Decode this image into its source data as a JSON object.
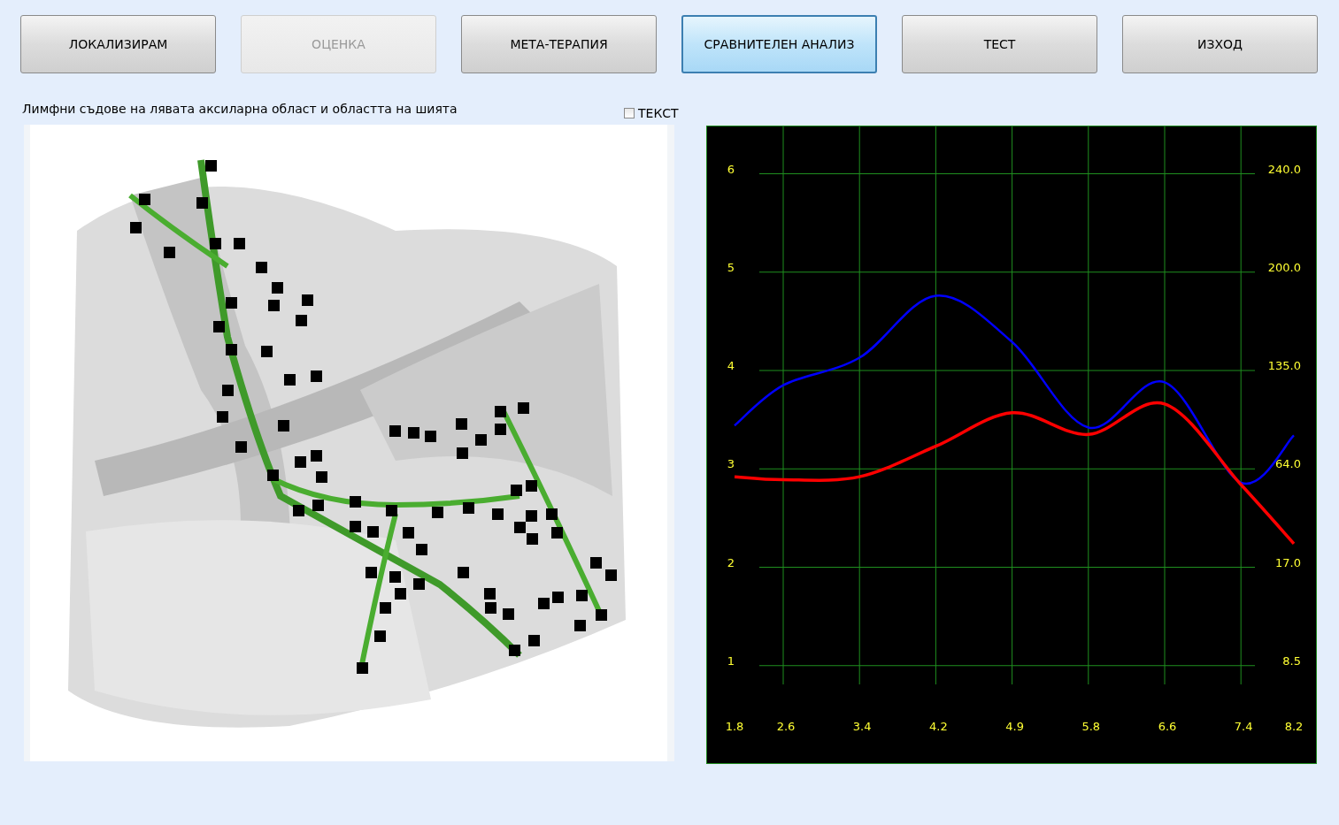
{
  "toolbar": {
    "buttons": [
      {
        "label": "ЛОКАЛИЗИРАМ",
        "selected": false,
        "disabled": false
      },
      {
        "label": "ОЦЕНКА",
        "selected": false,
        "disabled": true
      },
      {
        "label": "МЕТА-ТЕРАПИЯ",
        "selected": false,
        "disabled": false
      },
      {
        "label": "СРАВНИТЕЛЕН АНАЛИЗ",
        "selected": true,
        "disabled": false
      },
      {
        "label": "ТЕСТ",
        "selected": false,
        "disabled": false
      },
      {
        "label": "ИЗХОД",
        "selected": false,
        "disabled": false
      }
    ]
  },
  "caption": "Лимфни съдове на лявата аксиларна област и областта на шията",
  "text_checkbox": {
    "label": "ТЕКСТ",
    "checked": false
  },
  "chart": {
    "right_axis_labels": [
      "240.0",
      "200.0",
      "135.0",
      "64.0",
      "17.0",
      "8.5"
    ],
    "chart_data": {
      "type": "line",
      "categories": [
        "1.8",
        "2.6",
        "3.4",
        "4.2",
        "4.9",
        "5.8",
        "6.6",
        "7.4",
        "8.2"
      ],
      "yticks": [
        6,
        5,
        4,
        3,
        2,
        1
      ],
      "ylim": [
        0,
        6.49
      ],
      "grid": true,
      "series": [
        {
          "color": "#0000ff",
          "values": [
            3.44,
            3.85,
            4.13,
            4.76,
            4.29,
            3.42,
            3.88,
            2.86,
            3.34
          ]
        },
        {
          "color": "#ff0000",
          "values": [
            2.92,
            2.89,
            2.92,
            3.23,
            3.57,
            3.35,
            3.66,
            2.84,
            2.24
          ]
        }
      ]
    }
  }
}
